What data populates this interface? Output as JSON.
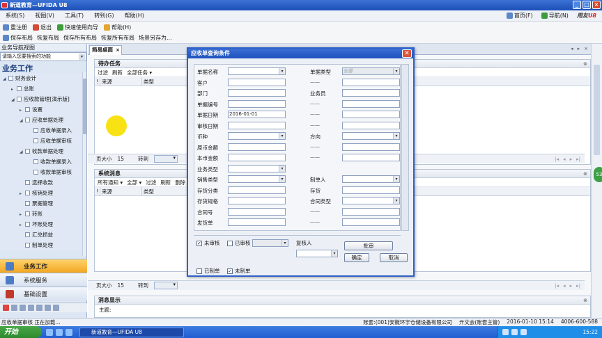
{
  "window": {
    "title": "新道教育—UFIDA U8"
  },
  "menu": {
    "items": [
      "系统(S)",
      "视图(V)",
      "工具(T)",
      "转到(G)",
      "帮助(H)"
    ],
    "home": "首页(F)",
    "nav": "导航(N)",
    "brand_a": "用友",
    "brand_b": "U8"
  },
  "toolbar1": {
    "items": [
      "重注册",
      "退出",
      "快速使用向导",
      "帮助(H)"
    ]
  },
  "toolbar2": {
    "items": [
      "保存布局",
      "恢复布局",
      "保存所有布局",
      "恢复所有布局",
      "场景另存为..."
    ]
  },
  "sidebar": {
    "header": "业务导航视图",
    "search_placeholder": "请输入您要搜索的功能",
    "title": "业务工作",
    "tree": [
      {
        "label": "财务会计",
        "arrow": "◢",
        "indent": 4
      },
      {
        "label": "总账",
        "arrow": "▸",
        "indent": 16
      },
      {
        "label": "应收款管理[演示版]",
        "arrow": "◢",
        "indent": 16
      },
      {
        "label": "设置",
        "arrow": "▸",
        "indent": 28
      },
      {
        "label": "应收单据处理",
        "arrow": "◢",
        "indent": 28
      },
      {
        "label": "应收单据录入",
        "arrow": "",
        "indent": 40
      },
      {
        "label": "应收单据审核",
        "arrow": "",
        "indent": 40
      },
      {
        "label": "收款单据处理",
        "arrow": "◢",
        "indent": 28
      },
      {
        "label": "收款单据录入",
        "arrow": "",
        "indent": 40
      },
      {
        "label": "收款单据审核",
        "arrow": "",
        "indent": 40
      },
      {
        "label": "选择收款",
        "arrow": "",
        "indent": 28
      },
      {
        "label": "核销处理",
        "arrow": "▸",
        "indent": 28
      },
      {
        "label": "票据管理",
        "arrow": "",
        "indent": 28
      },
      {
        "label": "转账",
        "arrow": "▸",
        "indent": 28
      },
      {
        "label": "坏账处理",
        "arrow": "▸",
        "indent": 28
      },
      {
        "label": "汇兑损益",
        "arrow": "",
        "indent": 28
      },
      {
        "label": "制单处理",
        "arrow": "",
        "indent": 28
      }
    ],
    "bottom": {
      "business": "业务工作",
      "system": "系统服务",
      "base": "基础设置"
    }
  },
  "main": {
    "tab": "简易桌面",
    "tab_close": "×",
    "todo": {
      "title": "待办任务",
      "tools": [
        "过滤",
        "刷新",
        "全部任务 ▾"
      ],
      "cols": [
        "!",
        "来源",
        "类型"
      ]
    },
    "pager1": {
      "size_label": "页大小",
      "size": "15",
      "goto": "转到"
    },
    "msgs": {
      "title": "系统消息",
      "tools": [
        "所有通知 ▾",
        "全部 ▾",
        "过滤",
        "刷新",
        "删除"
      ],
      "cols": [
        "!",
        "来源",
        "类型"
      ]
    },
    "pager2": {
      "size_label": "页大小",
      "size": "15",
      "goto": "转到"
    },
    "msgshow": {
      "title": "消息显示",
      "subject": "主题:"
    }
  },
  "dialog": {
    "title": "应收单查询条件",
    "close": "✕",
    "fields_left": [
      "单据名称",
      "客户",
      "部门",
      "单据编号",
      "单据日期",
      "审核日期",
      "币种",
      "原币金额",
      "本币金额",
      "业务类型",
      "销售类型",
      "存货分类",
      "存货规格",
      "合同号",
      "发货单"
    ],
    "date_value": "2016-01-01",
    "fields_right": {
      "type": "单据类型",
      "type_value": "全部",
      "clerk": "业务员",
      "dir": "方向",
      "maker": "制单人",
      "inv": "存货",
      "ctype": "合同类型"
    },
    "dash": "——",
    "cb_unaudited": "未审核",
    "cb_audited": "已审核",
    "reviewer": "复核人",
    "btn_batch": "批审",
    "btn_ok": "确定",
    "btn_cancel": "取消",
    "cb_made": "已制单",
    "cb_unmade": "未制单"
  },
  "statusbar": {
    "left": "应收单据审核 正在加载...",
    "user": "账套:(001)安徽环宇仓储设备有限公司",
    "op": "亓文会(账套主管)",
    "date": "2016-01-10 15:14",
    "tel": "4006-600-588"
  },
  "taskbar": {
    "start": "开始",
    "task": "新道教育—UFIDA U8",
    "clock": "15:22"
  },
  "float": {
    "badge": "53"
  }
}
